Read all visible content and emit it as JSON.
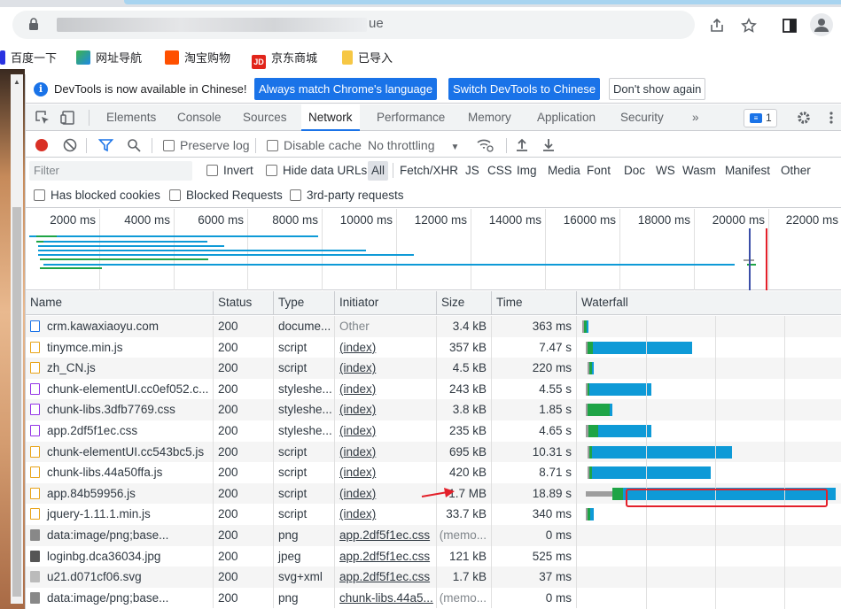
{
  "browser": {
    "url_suffix": "ue",
    "bookmarks": [
      "百度一下",
      "网址导航",
      "淘宝购物",
      "京东商城",
      "已导入"
    ]
  },
  "infobar": {
    "message": "DevTools is now available in Chinese!",
    "btn_match": "Always match Chrome's language",
    "btn_switch": "Switch DevTools to Chinese",
    "btn_dismiss": "Don't show again"
  },
  "tabs": [
    "Elements",
    "Console",
    "Sources",
    "Network",
    "Performance",
    "Memory",
    "Application",
    "Security",
    "»"
  ],
  "active_tab": "Network",
  "issues_count": "1",
  "toolbar": {
    "preserve_log": "Preserve log",
    "disable_cache": "Disable cache",
    "throttling": "No throttling"
  },
  "filter": {
    "placeholder": "Filter",
    "invert": "Invert",
    "hide_data_urls": "Hide data URLs",
    "types": [
      "All",
      "Fetch/XHR",
      "JS",
      "CSS",
      "Img",
      "Media",
      "Font",
      "Doc",
      "WS",
      "Wasm",
      "Manifest",
      "Other"
    ],
    "has_blocked_cookies": "Has blocked cookies",
    "blocked_requests": "Blocked Requests",
    "third_party": "3rd-party requests"
  },
  "overview": {
    "ticks": [
      "2000 ms",
      "4000 ms",
      "6000 ms",
      "8000 ms",
      "10000 ms",
      "12000 ms",
      "14000 ms",
      "16000 ms",
      "18000 ms",
      "20000 ms",
      "22000 ms"
    ]
  },
  "columns": {
    "name": "Name",
    "status": "Status",
    "type": "Type",
    "initiator": "Initiator",
    "size": "Size",
    "time": "Time",
    "waterfall": "Waterfall"
  },
  "rows": [
    {
      "name": "crm.kawaxiaoyu.com",
      "status": "200",
      "type": "docume...",
      "initiator": "Other",
      "size": "3.4 kB",
      "time": "363 ms",
      "icon": "document-icon",
      "icon_color": "#1a73e8",
      "initiator_link": false
    },
    {
      "name": "tinymce.min.js",
      "status": "200",
      "type": "script",
      "initiator": "(index)",
      "size": "357 kB",
      "time": "7.47 s",
      "icon": "script-icon",
      "icon_color": "#e8a317",
      "initiator_link": true
    },
    {
      "name": "zh_CN.js",
      "status": "200",
      "type": "script",
      "initiator": "(index)",
      "size": "4.5 kB",
      "time": "220 ms",
      "icon": "script-icon",
      "icon_color": "#e8a317",
      "initiator_link": true
    },
    {
      "name": "chunk-elementUI.cc0ef052.c...",
      "status": "200",
      "type": "styleshe...",
      "initiator": "(index)",
      "size": "243 kB",
      "time": "4.55 s",
      "icon": "stylesheet-icon",
      "icon_color": "#9334e6",
      "initiator_link": true
    },
    {
      "name": "chunk-libs.3dfb7769.css",
      "status": "200",
      "type": "styleshe...",
      "initiator": "(index)",
      "size": "3.8 kB",
      "time": "1.85 s",
      "icon": "stylesheet-icon",
      "icon_color": "#9334e6",
      "initiator_link": true
    },
    {
      "name": "app.2df5f1ec.css",
      "status": "200",
      "type": "styleshe...",
      "initiator": "(index)",
      "size": "235 kB",
      "time": "4.65 s",
      "icon": "stylesheet-icon",
      "icon_color": "#9334e6",
      "initiator_link": true
    },
    {
      "name": "chunk-elementUI.cc543bc5.js",
      "status": "200",
      "type": "script",
      "initiator": "(index)",
      "size": "695 kB",
      "time": "10.31 s",
      "icon": "script-icon",
      "icon_color": "#e8a317",
      "initiator_link": true
    },
    {
      "name": "chunk-libs.44a50ffa.js",
      "status": "200",
      "type": "script",
      "initiator": "(index)",
      "size": "420 kB",
      "time": "8.71 s",
      "icon": "script-icon",
      "icon_color": "#e8a317",
      "initiator_link": true
    },
    {
      "name": "app.84b59956.js",
      "status": "200",
      "type": "script",
      "initiator": "(index)",
      "size": "1.7 MB",
      "time": "18.89 s",
      "icon": "script-icon",
      "icon_color": "#e8a317",
      "initiator_link": true
    },
    {
      "name": "jquery-1.11.1.min.js",
      "status": "200",
      "type": "script",
      "initiator": "(index)",
      "size": "33.7 kB",
      "time": "340 ms",
      "icon": "script-icon",
      "icon_color": "#e8a317",
      "initiator_link": true
    },
    {
      "name": "data:image/png;base...",
      "status": "200",
      "type": "png",
      "initiator": "app.2df5f1ec.css",
      "size": "(memo...",
      "time": "0 ms",
      "icon": "image-icon",
      "icon_color": "#888888",
      "initiator_link": true
    },
    {
      "name": "loginbg.dca36034.jpg",
      "status": "200",
      "type": "jpeg",
      "initiator": "app.2df5f1ec.css",
      "size": "121 kB",
      "time": "525 ms",
      "icon": "image-icon",
      "icon_color": "#555555",
      "initiator_link": true
    },
    {
      "name": "u21.d071cf06.svg",
      "status": "200",
      "type": "svg+xml",
      "initiator": "app.2df5f1ec.css",
      "size": "1.7 kB",
      "time": "37 ms",
      "icon": "image-icon",
      "icon_color": "#bbbbbb",
      "initiator_link": true
    },
    {
      "name": "data:image/png;base...",
      "status": "200",
      "type": "png",
      "initiator": "chunk-libs.44a5...",
      "size": "(memo...",
      "time": "0 ms",
      "icon": "image-icon",
      "icon_color": "#888888",
      "initiator_link": true
    }
  ],
  "colors": {
    "accent": "#1a73e8",
    "record": "#d93025",
    "waterfall_blue": "#0e9ad7",
    "waterfall_green": "#1ea446",
    "waterfall_grey": "#9e9e9e",
    "highlight_red": "#e3202a"
  }
}
